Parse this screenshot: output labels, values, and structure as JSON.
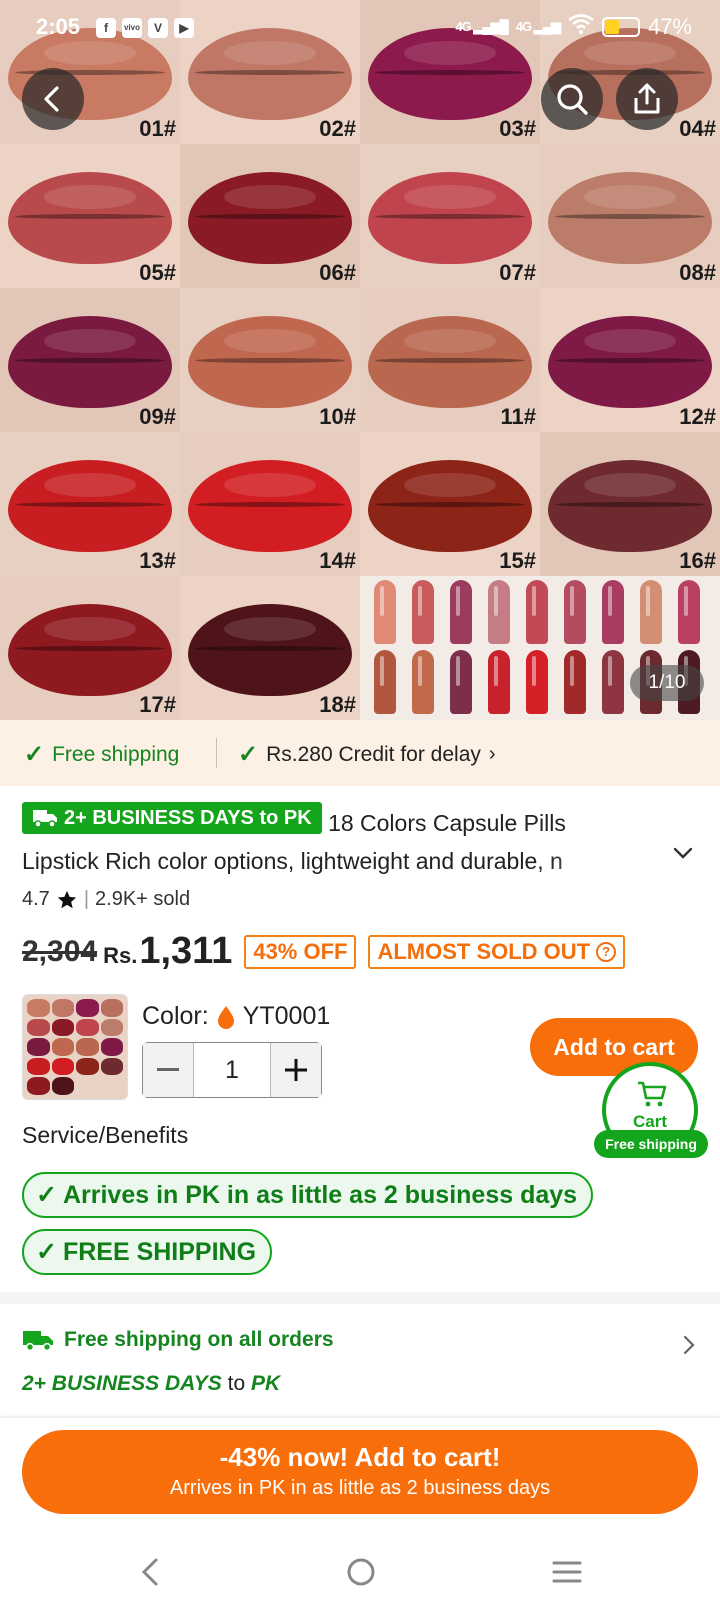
{
  "status_bar": {
    "time": "2:05",
    "app_icons": [
      "facebook-icon",
      "vivo-icon",
      "vimeo-icon",
      "youtube-icon"
    ],
    "network_1": "4G",
    "network_2": "4G",
    "battery": "47%"
  },
  "gallery": {
    "counter": "1/10",
    "swatches": [
      {
        "code": "01#",
        "color": "#c97a63"
      },
      {
        "code": "02#",
        "color": "#c07766"
      },
      {
        "code": "03#",
        "color": "#8d1a4c"
      },
      {
        "code": "04#",
        "color": "#b8705e"
      },
      {
        "code": "05#",
        "color": "#b94a4c"
      },
      {
        "code": "06#",
        "color": "#8a1b26"
      },
      {
        "code": "07#",
        "color": "#c0444d"
      },
      {
        "code": "08#",
        "color": "#bb7d69"
      },
      {
        "code": "09#",
        "color": "#7a1a3f"
      },
      {
        "code": "10#",
        "color": "#c0674f"
      },
      {
        "code": "11#",
        "color": "#b9674f"
      },
      {
        "code": "12#",
        "color": "#7e1a45"
      },
      {
        "code": "13#",
        "color": "#c81e21"
      },
      {
        "code": "14#",
        "color": "#d21d22"
      },
      {
        "code": "15#",
        "color": "#8c2418"
      },
      {
        "code": "16#",
        "color": "#6e2a2f"
      },
      {
        "code": "17#",
        "color": "#8e1a20"
      },
      {
        "code": "18#",
        "color": "#4f1419"
      }
    ],
    "capsule_colors_top": [
      "#e08a76",
      "#c95b5c",
      "#9b3b5e",
      "#c67c84",
      "#c24956",
      "#b44c60",
      "#a93d61",
      "#d38f74",
      "#b94063"
    ],
    "capsule_colors_bottom": [
      "#b35640",
      "#c2694c",
      "#7d2e4b",
      "#c8222d",
      "#d42026",
      "#a12929",
      "#8f3542",
      "#6d2a2e",
      "#4f1b22"
    ]
  },
  "shipping_strip": {
    "free_shipping": "Free shipping",
    "credit": "Rs.280 Credit for delay"
  },
  "product": {
    "delivery_badge": "2+ BUSINESS DAYS to PK",
    "title_line1": "18 Colors Capsule Pills",
    "title_line2": "Lipstick Rich color options, lightweight and durable, n",
    "rating": "4.7",
    "sold": "2.9K+ sold",
    "old_price": "2,304",
    "currency": "Rs.",
    "price": "1,311",
    "discount_tag": "43% OFF",
    "stock_tag": "ALMOST SOLD OUT"
  },
  "variant": {
    "color_label": "Color:",
    "color_value": "YT0001",
    "quantity": "1",
    "add_to_cart": "Add to cart",
    "cart_label": "Cart",
    "cart_badge": "Free shipping"
  },
  "service": {
    "title": "Service/Benefits",
    "benefit_1": "Arrives in PK in as little as 2 business days",
    "benefit_2": "FREE SHIPPING"
  },
  "shipping": {
    "title": "Free shipping on all orders",
    "days": "2+ BUSINESS DAYS",
    "to": "to",
    "country": "PK"
  },
  "cta": {
    "line1": "-43% now! Add to cart!",
    "line2": "Arrives in PK in as little as 2 business days"
  },
  "colors": {
    "brand_orange": "#f76e0a",
    "success_green": "#15a51c",
    "strip_bg": "#fdf0e4"
  }
}
